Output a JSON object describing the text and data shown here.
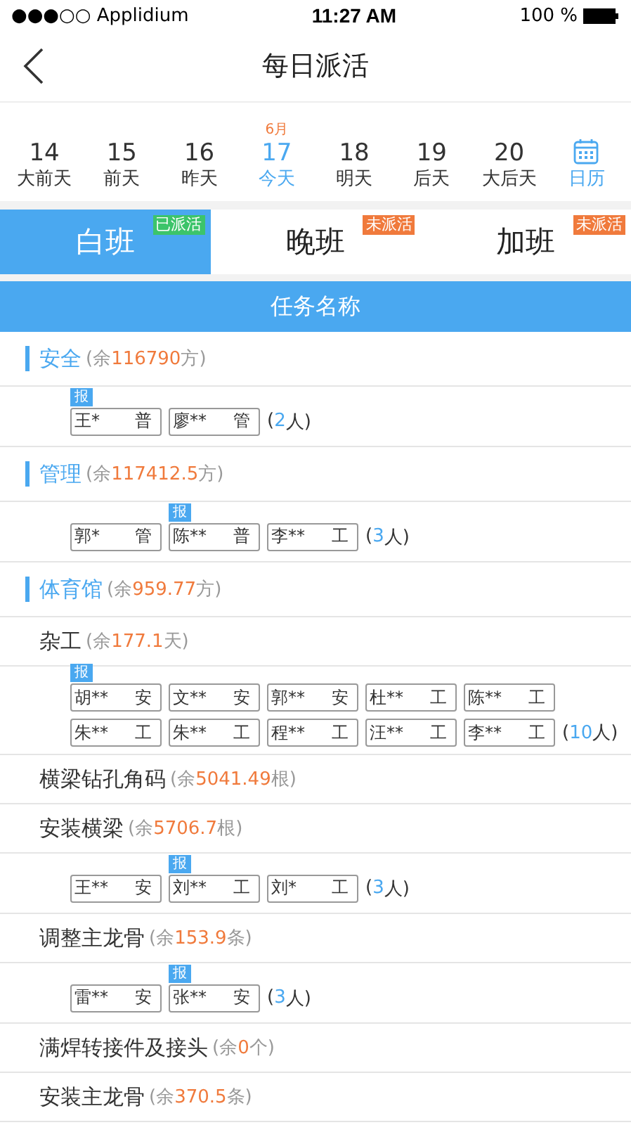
{
  "status_bar": {
    "carrier": "●●●○○ Applidium",
    "time": "11:27 AM",
    "battery": "100 %"
  },
  "nav": {
    "title": "每日派活"
  },
  "dates": [
    {
      "day": "14",
      "label": "大前天",
      "selected": false
    },
    {
      "day": "15",
      "label": "前天",
      "selected": false
    },
    {
      "day": "16",
      "label": "昨天",
      "selected": false
    },
    {
      "day": "17",
      "label": "今天",
      "month": "6月",
      "selected": true
    },
    {
      "day": "18",
      "label": "明天",
      "selected": false
    },
    {
      "day": "19",
      "label": "后天",
      "selected": false
    },
    {
      "day": "20",
      "label": "大后天",
      "selected": false
    }
  ],
  "calendar": {
    "label": "日历"
  },
  "shifts": [
    {
      "label": "白班",
      "status": "已派活",
      "dispatched": true,
      "selected": true
    },
    {
      "label": "晚班",
      "status": "未派活",
      "dispatched": false,
      "selected": false
    },
    {
      "label": "加班",
      "status": "未派活",
      "dispatched": false,
      "selected": false
    }
  ],
  "table_header": "任务名称",
  "rows": [
    {
      "kind": "category",
      "name": "安全",
      "open": "(余",
      "value": "116790",
      "close": "方)"
    },
    {
      "kind": "workers",
      "workers": [
        {
          "name": "王*",
          "role": "普",
          "badge": "报"
        },
        {
          "name": "廖**",
          "role": "管"
        }
      ],
      "count": {
        "open": "(",
        "value": "2",
        "close": "人)"
      }
    },
    {
      "kind": "category",
      "name": "管理",
      "open": "(余",
      "value": "117412.5",
      "close": "方)"
    },
    {
      "kind": "workers",
      "workers": [
        {
          "name": "郭*",
          "role": "管"
        },
        {
          "name": "陈**",
          "role": "普",
          "badge": "报"
        },
        {
          "name": "李**",
          "role": "工"
        }
      ],
      "count": {
        "open": "(",
        "value": "3",
        "close": "人)"
      }
    },
    {
      "kind": "category",
      "name": "体育馆",
      "open": "(余",
      "value": "959.77",
      "close": "方)"
    },
    {
      "kind": "task",
      "name": "杂工",
      "open": "(余",
      "value": "177.1",
      "close": "天)"
    },
    {
      "kind": "workers",
      "workers": [
        {
          "name": "胡**",
          "role": "安",
          "badge": "报"
        },
        {
          "name": "文**",
          "role": "安"
        },
        {
          "name": "郭**",
          "role": "安"
        },
        {
          "name": "杜**",
          "role": "工"
        },
        {
          "name": "陈**",
          "role": "工"
        },
        {
          "name": "朱**",
          "role": "工"
        },
        {
          "name": "朱**",
          "role": "工"
        },
        {
          "name": "程**",
          "role": "工"
        },
        {
          "name": "汪**",
          "role": "工"
        },
        {
          "name": "李**",
          "role": "工"
        }
      ],
      "count": {
        "open": "(",
        "value": "10",
        "close": "人)"
      }
    },
    {
      "kind": "task",
      "name": "横梁钻孔角码",
      "open": "(余",
      "value": "5041.49",
      "close": "根)"
    },
    {
      "kind": "task",
      "name": "安装横梁",
      "open": "(余",
      "value": "5706.7",
      "close": "根)"
    },
    {
      "kind": "workers",
      "workers": [
        {
          "name": "王**",
          "role": "安"
        },
        {
          "name": "刘**",
          "role": "工",
          "badge": "报"
        },
        {
          "name": "刘*",
          "role": "工"
        }
      ],
      "count": {
        "open": "(",
        "value": "3",
        "close": "人)"
      }
    },
    {
      "kind": "task",
      "name": "调整主龙骨",
      "open": "(余",
      "value": "153.9",
      "close": "条)"
    },
    {
      "kind": "workers",
      "workers": [
        {
          "name": "雷**",
          "role": "安"
        },
        {
          "name": "张**",
          "role": "安",
          "badge": "报"
        }
      ],
      "count": {
        "open": "(",
        "value": "3",
        "close": "人)"
      }
    },
    {
      "kind": "task",
      "name": "满焊转接件及接头",
      "open": "(余",
      "value": "0",
      "close": "个)"
    },
    {
      "kind": "task",
      "name": "安装主龙骨",
      "open": "(余",
      "value": "370.5",
      "close": "条)"
    }
  ]
}
